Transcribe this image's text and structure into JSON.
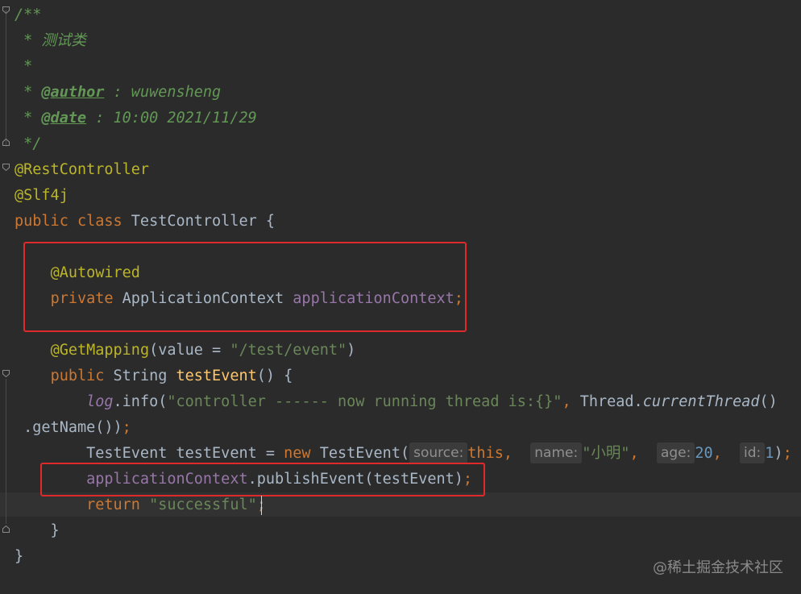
{
  "editor": {
    "lines": [
      [
        {
          "t": "/**",
          "c": "c-doc"
        }
      ],
      [
        {
          "t": " * 测试类",
          "c": "c-doc"
        }
      ],
      [
        {
          "t": " *",
          "c": "c-doc"
        }
      ],
      [
        {
          "t": " * ",
          "c": "c-doc"
        },
        {
          "t": "@author",
          "c": "c-tag"
        },
        {
          "t": " : wuwensheng",
          "c": "c-doc"
        }
      ],
      [
        {
          "t": " * ",
          "c": "c-doc"
        },
        {
          "t": "@date",
          "c": "c-tag"
        },
        {
          "t": " : 10:00 2021/11/29",
          "c": "c-doc"
        }
      ],
      [
        {
          "t": " */",
          "c": "c-doc"
        }
      ],
      [
        {
          "t": "@RestController",
          "c": "c-ann"
        }
      ],
      [
        {
          "t": "@Slf4j",
          "c": "c-ann"
        }
      ],
      [
        {
          "t": "public class ",
          "c": "c-kw"
        },
        {
          "t": "TestController {",
          "c": "c-txt"
        }
      ],
      [],
      [
        {
          "t": "    "
        },
        {
          "t": "@Autowired",
          "c": "c-ann"
        }
      ],
      [
        {
          "t": "    "
        },
        {
          "t": "private ",
          "c": "c-kw"
        },
        {
          "t": "ApplicationContext ",
          "c": "c-txt"
        },
        {
          "t": "applicationContext",
          "c": "c-fld"
        },
        {
          "t": ";",
          "c": "c-kw"
        }
      ],
      [],
      [
        {
          "t": "    "
        },
        {
          "t": "@GetMapping",
          "c": "c-ann"
        },
        {
          "t": "(value = ",
          "c": "c-txt"
        },
        {
          "t": "\"/test/event\"",
          "c": "c-str"
        },
        {
          "t": ")",
          "c": "c-txt"
        }
      ],
      [
        {
          "t": "    "
        },
        {
          "t": "public ",
          "c": "c-kw"
        },
        {
          "t": "String ",
          "c": "c-txt"
        },
        {
          "t": "testEvent",
          "c": "c-fn"
        },
        {
          "t": "() {",
          "c": "c-txt"
        }
      ],
      [
        {
          "t": "        "
        },
        {
          "t": "log",
          "c": "c-fldi"
        },
        {
          "t": ".info(",
          "c": "c-txt"
        },
        {
          "t": "\"controller ------ now running thread is:{}\"",
          "c": "c-str"
        },
        {
          "t": ", ",
          "c": "c-kw"
        },
        {
          "t": "Thread.",
          "c": "c-txt"
        },
        {
          "t": "currentThread",
          "c": "c-ital"
        },
        {
          "t": "()",
          "c": "c-txt"
        }
      ],
      [
        {
          "t": " .getName())",
          "c": "c-txt"
        },
        {
          "t": ";",
          "c": "c-kw"
        }
      ],
      [
        {
          "t": "        "
        },
        {
          "t": "TestEvent testEvent = ",
          "c": "c-txt"
        },
        {
          "t": "new ",
          "c": "c-kw"
        },
        {
          "t": "TestEvent(",
          "c": "c-txt"
        },
        {
          "hint": "source:"
        },
        {
          "t": "this",
          "c": "c-kw"
        },
        {
          "t": ",  ",
          "c": "c-kw"
        },
        {
          "hint": "name:"
        },
        {
          "t": "\"小明\"",
          "c": "c-str"
        },
        {
          "t": ",  ",
          "c": "c-kw"
        },
        {
          "hint": "age:"
        },
        {
          "t": "20",
          "c": "c-num"
        },
        {
          "t": ",  ",
          "c": "c-kw"
        },
        {
          "hint": "id:"
        },
        {
          "t": "1",
          "c": "c-num"
        },
        {
          "t": ")",
          "c": "c-txt"
        },
        {
          "t": ";",
          "c": "c-kw"
        }
      ],
      [
        {
          "t": "        "
        },
        {
          "t": "applicationContext",
          "c": "c-fld"
        },
        {
          "t": ".publishEvent(testEvent)",
          "c": "c-txt"
        },
        {
          "t": ";",
          "c": "c-kw"
        }
      ],
      [
        {
          "t": "        "
        },
        {
          "t": "return ",
          "c": "c-kw"
        },
        {
          "t": "\"successful\"",
          "c": "c-str"
        },
        {
          "t": ";",
          "c": "c-kw"
        }
      ],
      [
        {
          "t": "    }",
          "c": "c-txt"
        }
      ],
      [
        {
          "t": "}",
          "c": "c-txt"
        }
      ]
    ]
  },
  "watermark": "@稀土掘金技术社区",
  "colors": {
    "background": "#2b2b2b",
    "highlight_box": "#e0292b",
    "doc_comment": "#629755",
    "annotation": "#bbb529",
    "keyword": "#cc7832",
    "field": "#9876aa",
    "string": "#6a8759",
    "number": "#6897bb",
    "method": "#ffc66d"
  },
  "icons": [
    "fold-marker-icon"
  ]
}
